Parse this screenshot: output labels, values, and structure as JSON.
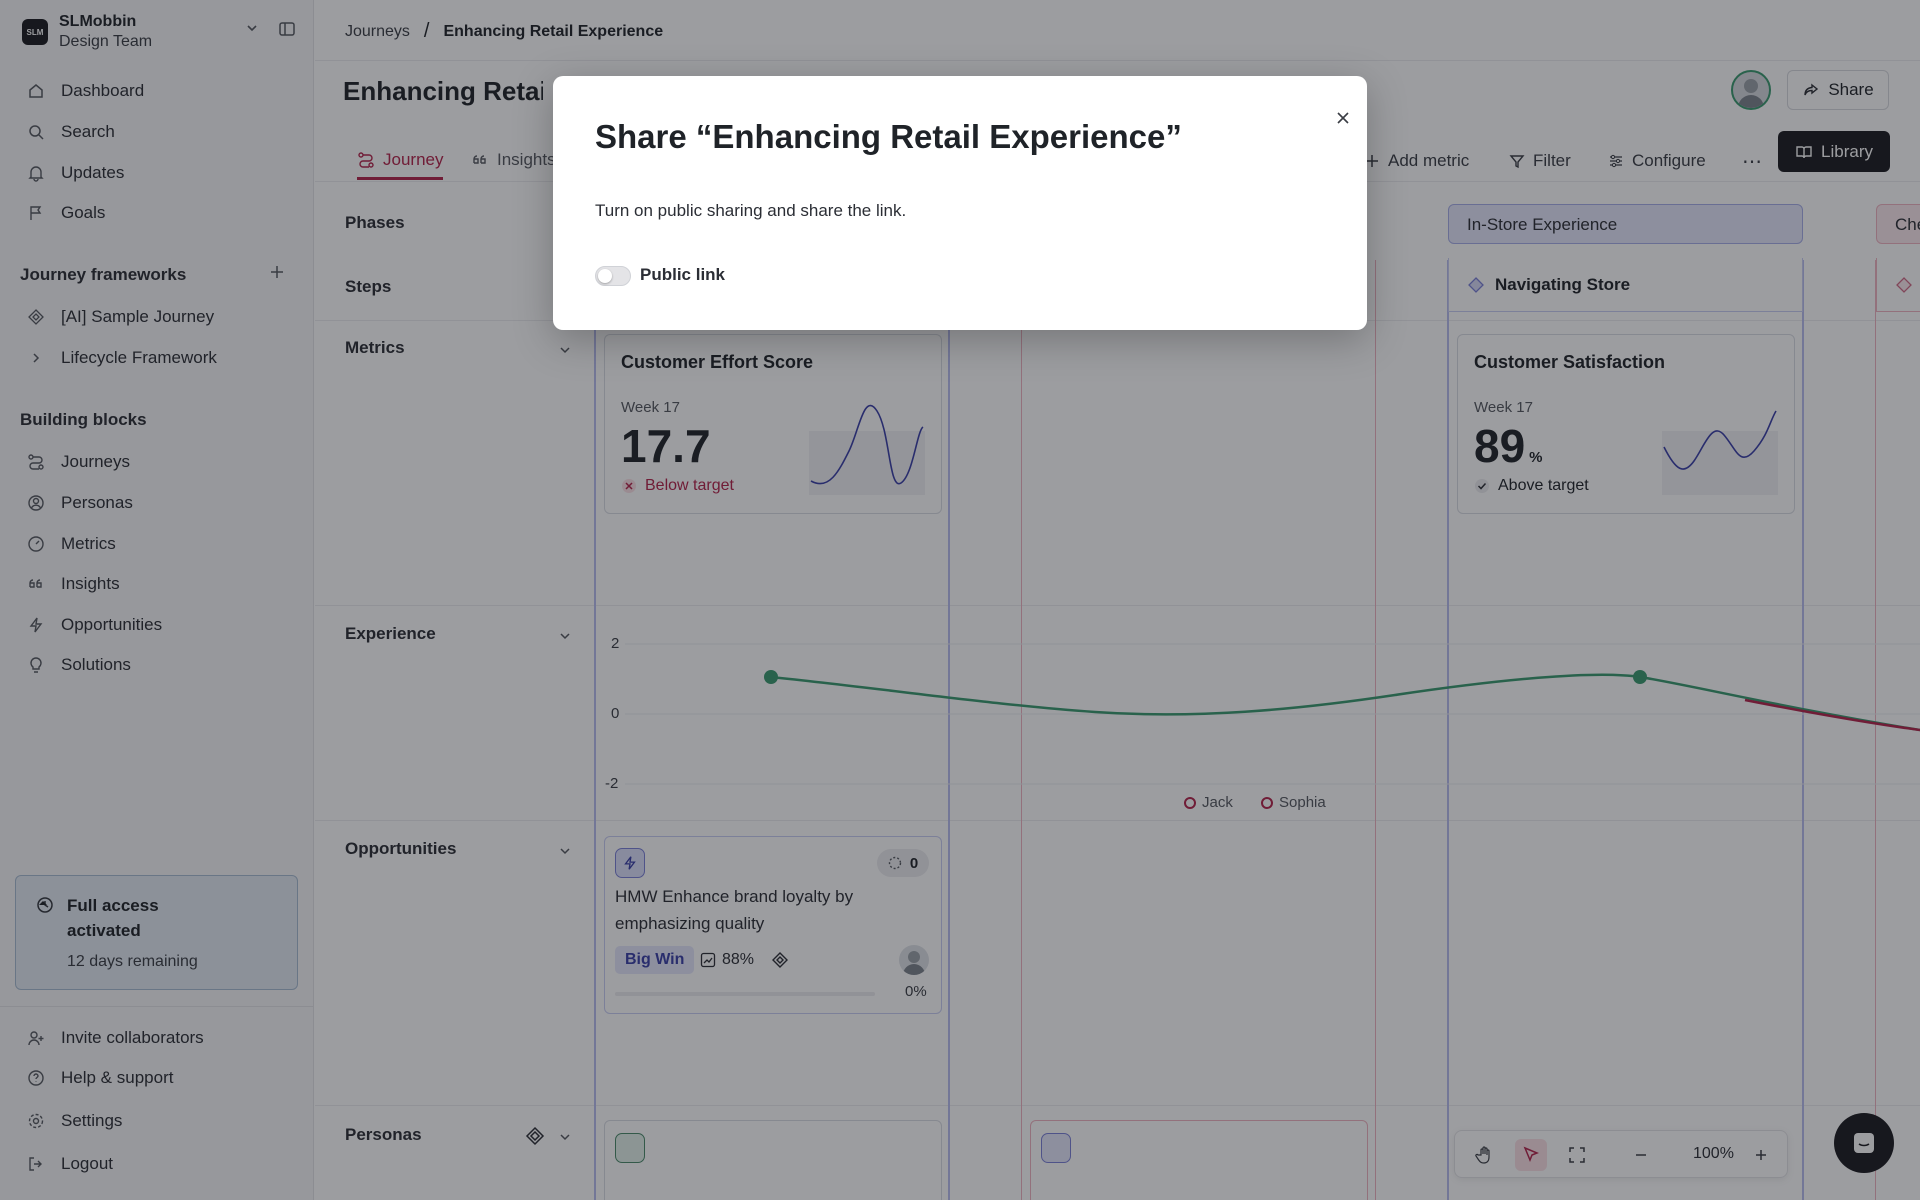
{
  "sidebar": {
    "team": {
      "logo": "SLM",
      "name": "SLMobbin",
      "subtitle": "Design Team"
    },
    "nav": [
      {
        "label": "Dashboard",
        "icon": "home-icon"
      },
      {
        "label": "Search",
        "icon": "search-icon"
      },
      {
        "label": "Updates",
        "icon": "bell-icon"
      },
      {
        "label": "Goals",
        "icon": "flag-icon"
      }
    ],
    "frameworks_title": "Journey frameworks",
    "frameworks": [
      {
        "label": "[AI] Sample Journey",
        "icon": "framework-icon"
      },
      {
        "label": "Lifecycle Framework",
        "icon": "chevron-right-icon"
      }
    ],
    "blocks_title": "Building blocks",
    "blocks": [
      {
        "label": "Journeys",
        "icon": "journey-icon"
      },
      {
        "label": "Personas",
        "icon": "persona-icon"
      },
      {
        "label": "Metrics",
        "icon": "gauge-icon"
      },
      {
        "label": "Insights",
        "icon": "quote-icon"
      },
      {
        "label": "Opportunities",
        "icon": "bolt-icon"
      },
      {
        "label": "Solutions",
        "icon": "bulb-icon"
      }
    ],
    "trial": {
      "title": "Full access activated",
      "subtitle": "12 days remaining"
    },
    "footer": [
      {
        "label": "Invite collaborators",
        "icon": "user-plus-icon"
      },
      {
        "label": "Help & support",
        "icon": "help-icon"
      },
      {
        "label": "Settings",
        "icon": "gear-icon"
      },
      {
        "label": "Logout",
        "icon": "logout-icon"
      }
    ]
  },
  "header": {
    "breadcrumb": [
      "Journeys",
      "Enhancing Retail Experience"
    ],
    "breadcrumb_sep": "/",
    "title": "Enhancing Retail Experience",
    "share_label": "Share"
  },
  "tabs": [
    {
      "label": "Journey",
      "active": true
    },
    {
      "label": "Insights",
      "active": false
    }
  ],
  "toolbar": {
    "add_metric": "Add metric",
    "filter": "Filter",
    "configure": "Configure",
    "more": "⋯",
    "library": "Library"
  },
  "rows": {
    "phases": "Phases",
    "steps": "Steps",
    "metrics": "Metrics",
    "experience": "Experience",
    "opportunities": "Opportunities",
    "personas": "Personas"
  },
  "phases": [
    {
      "label": "In-Store Experience"
    },
    {
      "label": "Che"
    }
  ],
  "steps": [
    {
      "label": "Navigating Store"
    }
  ],
  "metrics": [
    {
      "title": "Customer Effort Score",
      "week": "Week 17",
      "value": "17.7",
      "unit": "",
      "status": "Below target",
      "status_color": "#b4234a"
    },
    {
      "title": "Customer Satisfaction",
      "week": "Week 17",
      "value": "89",
      "unit": "%",
      "status": "Above target",
      "status_color": "#2b2e35"
    }
  ],
  "experience": {
    "y_ticks": [
      "2",
      "0",
      "-2"
    ],
    "legend": [
      "Jack",
      "Sophia"
    ],
    "line_color": "#3a9a6f",
    "negative_color": "#b4234a"
  },
  "opportunity": {
    "count": "0",
    "title": "HMW Enhance brand loyalty by emphasizing quality",
    "tag": "Big Win",
    "score": "88%",
    "progress": "0%"
  },
  "zoom": {
    "value": "100%"
  },
  "modal": {
    "title": "Share “Enhancing Retail Experience”",
    "description": "Turn on public sharing and share the link.",
    "toggle_label": "Public link",
    "toggle_on": false
  },
  "colors": {
    "accent": "#b4234a",
    "brand_dark": "#1b1b1f",
    "phase_fill": "#e6e7fb"
  }
}
